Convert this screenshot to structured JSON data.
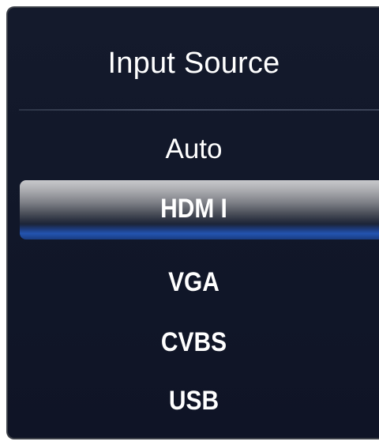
{
  "menu": {
    "title": "Input Source",
    "items": [
      {
        "label": "Auto",
        "selected": false
      },
      {
        "label": "HDM I",
        "selected": true
      },
      {
        "label": "VGA",
        "selected": false
      },
      {
        "label": "CVBS",
        "selected": false
      },
      {
        "label": "USB",
        "selected": false
      }
    ]
  },
  "colors": {
    "panel_background": "#121829",
    "text": "#ffffff",
    "highlight_top": "#c8c9cc",
    "highlight_bottom_accent": "#2354b0"
  }
}
